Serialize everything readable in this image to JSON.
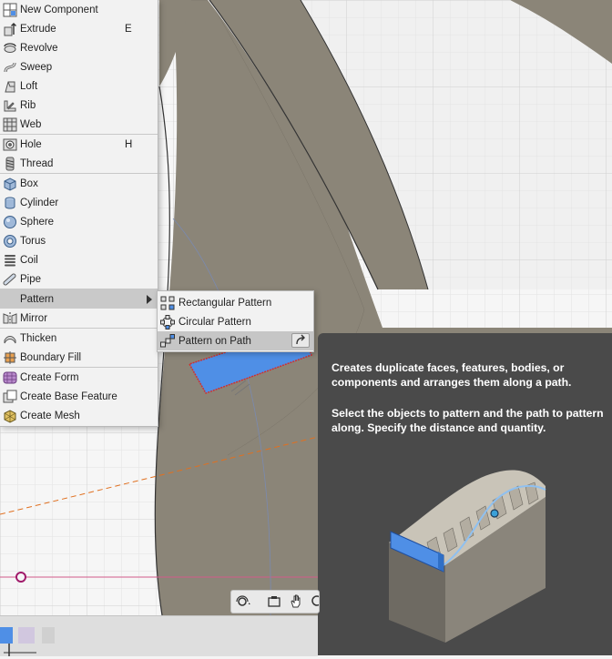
{
  "menu": {
    "items": [
      {
        "label": "New Component",
        "icon": "new-component-icon",
        "shortcut": ""
      },
      {
        "label": "Extrude",
        "icon": "extrude-icon",
        "shortcut": "E"
      },
      {
        "label": "Revolve",
        "icon": "revolve-icon",
        "shortcut": ""
      },
      {
        "label": "Sweep",
        "icon": "sweep-icon",
        "shortcut": ""
      },
      {
        "label": "Loft",
        "icon": "loft-icon",
        "shortcut": ""
      },
      {
        "label": "Rib",
        "icon": "rib-icon",
        "shortcut": ""
      },
      {
        "label": "Web",
        "icon": "web-icon",
        "shortcut": ""
      },
      {
        "label": "Hole",
        "icon": "hole-icon",
        "shortcut": "H"
      },
      {
        "label": "Thread",
        "icon": "thread-icon",
        "shortcut": ""
      },
      {
        "label": "Box",
        "icon": "box-icon",
        "shortcut": ""
      },
      {
        "label": "Cylinder",
        "icon": "cylinder-icon",
        "shortcut": ""
      },
      {
        "label": "Sphere",
        "icon": "sphere-icon",
        "shortcut": ""
      },
      {
        "label": "Torus",
        "icon": "torus-icon",
        "shortcut": ""
      },
      {
        "label": "Coil",
        "icon": "coil-icon",
        "shortcut": ""
      },
      {
        "label": "Pipe",
        "icon": "pipe-icon",
        "shortcut": ""
      },
      {
        "label": "Pattern",
        "icon": "",
        "shortcut": ""
      },
      {
        "label": "Mirror",
        "icon": "mirror-icon",
        "shortcut": ""
      },
      {
        "label": "Thicken",
        "icon": "thicken-icon",
        "shortcut": ""
      },
      {
        "label": "Boundary Fill",
        "icon": "boundary-fill-icon",
        "shortcut": ""
      },
      {
        "label": "Create Form",
        "icon": "create-form-icon",
        "shortcut": ""
      },
      {
        "label": "Create Base Feature",
        "icon": "create-base-feature-icon",
        "shortcut": ""
      },
      {
        "label": "Create Mesh",
        "icon": "create-mesh-icon",
        "shortcut": ""
      }
    ]
  },
  "submenu": {
    "items": [
      {
        "label": "Rectangular Pattern",
        "icon": "rectangular-pattern-icon"
      },
      {
        "label": "Circular Pattern",
        "icon": "circular-pattern-icon"
      },
      {
        "label": "Pattern on Path",
        "icon": "pattern-on-path-icon"
      }
    ]
  },
  "tooltip": {
    "paragraph1": "Creates duplicate faces, features, bodies, or components and arranges them along a path.",
    "paragraph2": "Select the objects to pattern and the path to pattern along. Specify the distance and quantity."
  },
  "colors": {
    "accent": "#3d7fd6",
    "model_surface": "#8b8578",
    "menu_bg": "#f2f2f2",
    "highlight": "#c9c9c9",
    "tooltip_bg": "#4a4a4a",
    "sketch_line": "#e07020"
  },
  "toolbar": {
    "icons": [
      "orbit-icon",
      "look-at-icon",
      "pan-icon",
      "zoom-icon"
    ]
  }
}
